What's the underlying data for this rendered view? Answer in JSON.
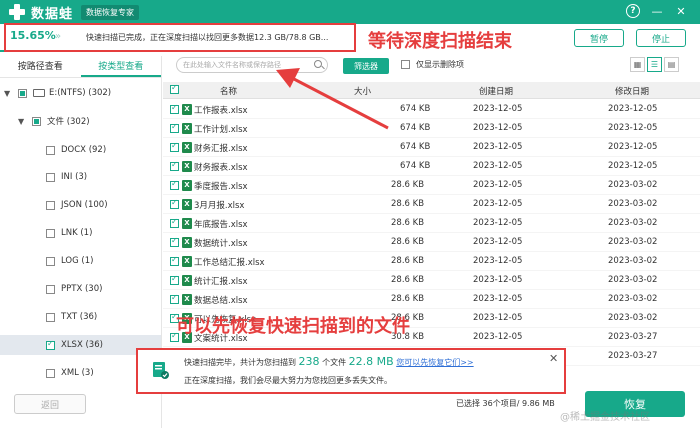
{
  "titlebar": {
    "app_name": "数据蛙",
    "app_subtitle": "数据恢复专家",
    "help_label": "?",
    "minimize_label": "—",
    "close_label": "✕",
    "bg_color": "#17a98a"
  },
  "progress": {
    "percent_label": "15.65%",
    "percent_value": 15.65,
    "status_text": "快速扫描已完成，正在深度扫描以找回更多数据12.3 GB/78.8 GB...",
    "pause_label": "暂停",
    "stop_label": "停止"
  },
  "annotations": {
    "top_hint": "等待深度扫描结束",
    "bottom_hint": "可以先恢复快速扫描到的文件",
    "color": "#e53e3e"
  },
  "sidebar": {
    "tabs": [
      "按路径查看",
      "按类型查看"
    ],
    "active_tab": 1,
    "tree": [
      {
        "label": "E:(NTFS) (302)"
      },
      {
        "label": "文件 (302)"
      },
      {
        "label": "DOCX (92)"
      },
      {
        "label": "INI (3)"
      },
      {
        "label": "JSON (100)"
      },
      {
        "label": "LNK (1)"
      },
      {
        "label": "LOG (1)"
      },
      {
        "label": "PPTX (30)"
      },
      {
        "label": "TXT (36)"
      },
      {
        "label": "XLSX (36)"
      },
      {
        "label": "XML (3)"
      }
    ],
    "back_label": "返回"
  },
  "toolbar": {
    "search_placeholder": "在此处输入文件名称或保存路径",
    "filter_label": "筛选器",
    "deleted_only_label": "仅显示删除项"
  },
  "table": {
    "headers": [
      "名称",
      "大小",
      "创建日期",
      "修改日期"
    ],
    "rows": [
      {
        "name": "工作报表.xlsx",
        "size": "674 KB",
        "created": "2023-12-05",
        "modified": "2023-12-05"
      },
      {
        "name": "工作计划.xlsx",
        "size": "674 KB",
        "created": "2023-12-05",
        "modified": "2023-12-05"
      },
      {
        "name": "财务汇报.xlsx",
        "size": "674 KB",
        "created": "2023-12-05",
        "modified": "2023-12-05"
      },
      {
        "name": "财务报表.xlsx",
        "size": "674 KB",
        "created": "2023-12-05",
        "modified": "2023-12-05"
      },
      {
        "name": "季度报告.xlsx",
        "size": "28.6 KB",
        "created": "2023-12-05",
        "modified": "2023-03-02"
      },
      {
        "name": "3月月报.xlsx",
        "size": "28.6 KB",
        "created": "2023-12-05",
        "modified": "2023-03-02"
      },
      {
        "name": "年底报告.xlsx",
        "size": "28.6 KB",
        "created": "2023-12-05",
        "modified": "2023-03-02"
      },
      {
        "name": "数据统计.xlsx",
        "size": "28.6 KB",
        "created": "2023-12-05",
        "modified": "2023-03-02"
      },
      {
        "name": "工作总结汇报.xlsx",
        "size": "28.6 KB",
        "created": "2023-12-05",
        "modified": "2023-03-02"
      },
      {
        "name": "统计汇报.xlsx",
        "size": "28.6 KB",
        "created": "2023-12-05",
        "modified": "2023-03-02"
      },
      {
        "name": "数据总结.xlsx",
        "size": "28.6 KB",
        "created": "2023-12-05",
        "modified": "2023-03-02"
      },
      {
        "name": "可以先恢复.xlsx",
        "size": "28.6 KB",
        "created": "2023-12-05",
        "modified": "2023-03-02"
      },
      {
        "name": "文案统计.xlsx",
        "size": "30.8 KB",
        "created": "2023-12-05",
        "modified": "2023-03-27"
      },
      {
        "name": "",
        "size": "",
        "created": "",
        "modified": "2023-03-27"
      }
    ]
  },
  "notification": {
    "line1_prefix": "快速扫描完毕，共计为您扫描到",
    "file_count": "238",
    "line1_mid": "个文件",
    "total_size": "22.8 MB",
    "link_text": "您可以先恢复它们>>",
    "line2": "正在深度扫描，我们会尽最大努力为您找回更多丢失文件。",
    "close_label": "✕"
  },
  "footer": {
    "selected_info": "已选择 36个项目/ 9.86 MB",
    "recover_label": "恢复",
    "watermark": "@稀土掘金技术社区"
  }
}
